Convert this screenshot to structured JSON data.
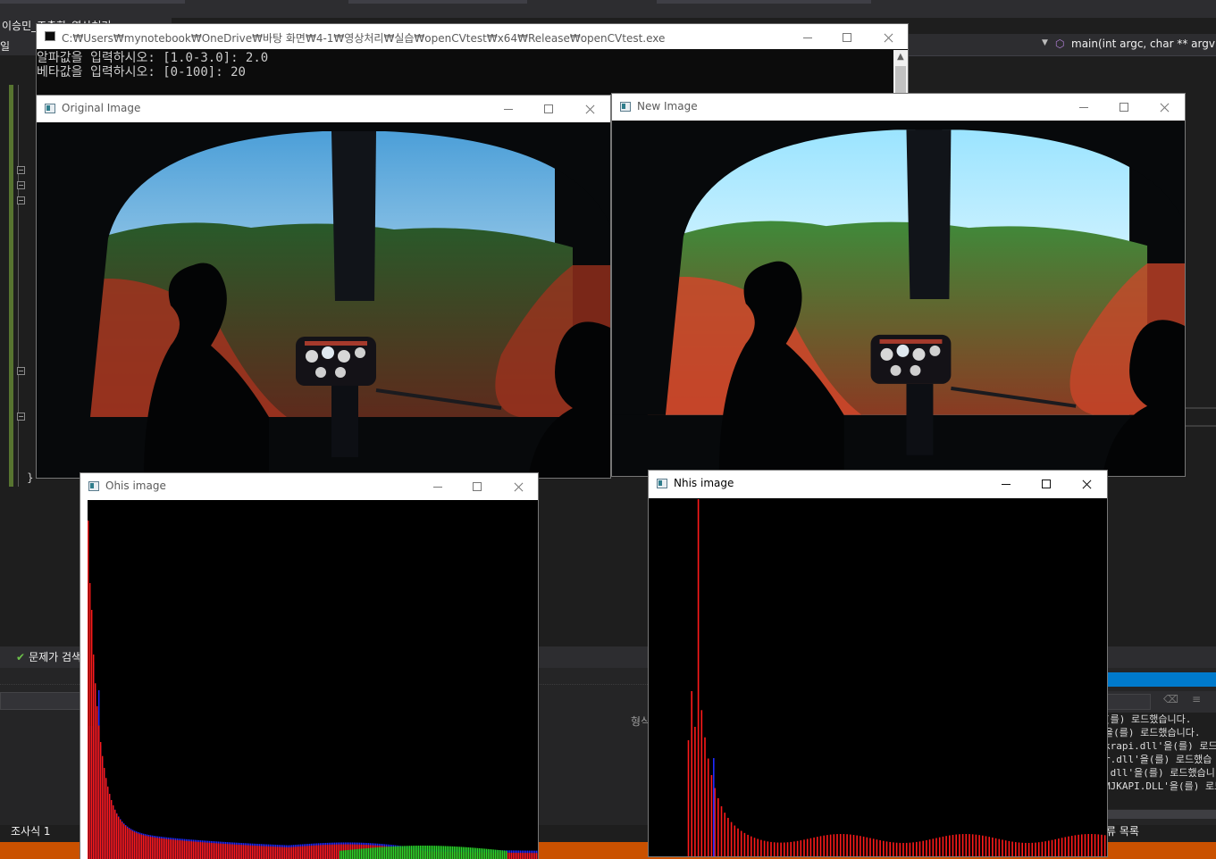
{
  "vs": {
    "tab_label": "이승민_조촐한_영상처리",
    "left_nav_label": "일",
    "function_nav": "main(int argc, char ** argv)",
    "problems_label": "문제가 검색",
    "type_label": "형식",
    "watch_label": "조사식 1",
    "error_list_label": "류 목록",
    "output_lines": [
      "(를) 로드했습니다.",
      "을(를) 로드했습니다.",
      "krapi.dll'을(를) 로드",
      "r.dll'을(를) 로드했습",
      ".dll'을(를) 로드했습니",
      "MJKAPI.DLL'을(를) 로드"
    ]
  },
  "console": {
    "title": "C:₩Users₩mynotebook₩OneDrive₩바탕 화면₩4-1₩영상처리₩실습₩openCVtest₩x64₩Release₩openCVtest.exe",
    "lines": [
      "알파값을 입력하시오: [1.0-3.0]: 2.0",
      "베타값을 입력하시오: [0-100]: 20"
    ]
  },
  "windows": {
    "original": {
      "title": "Original Image"
    },
    "new": {
      "title": "New Image"
    },
    "ohis": {
      "title": "Ohis image"
    },
    "nhis": {
      "title": "Nhis image"
    }
  },
  "colors": {
    "vs_bg": "#1e1e1e",
    "vs_status": "#ca5100",
    "vs_accent": "#007acc",
    "hist_red": "#ff1a1a",
    "hist_blue": "#1f2bff",
    "hist_green": "#2bd92b"
  },
  "icons": {
    "minimize": "minimize-icon",
    "maximize": "maximize-icon",
    "close": "close-icon",
    "window": "opencv-window-icon",
    "check": "check-circle-icon"
  }
}
